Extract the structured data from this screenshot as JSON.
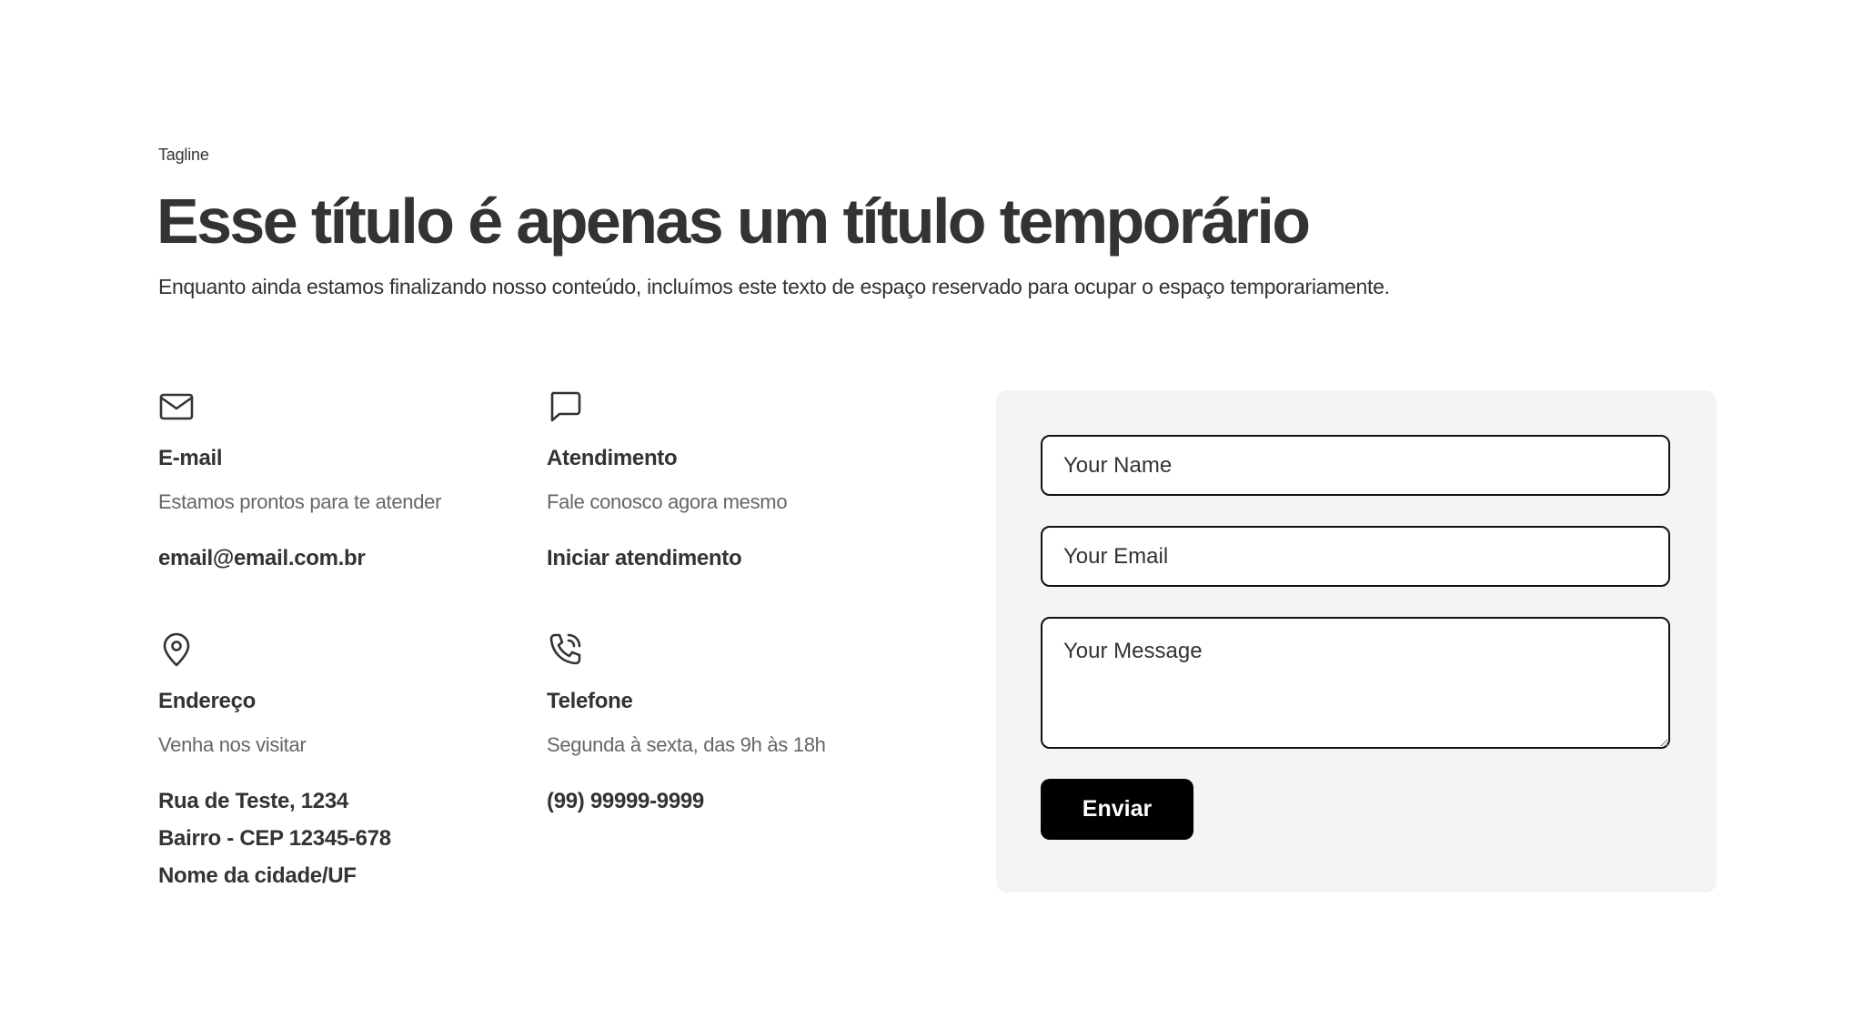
{
  "header": {
    "tagline": "Tagline",
    "title": "Esse título é apenas um título temporário",
    "subtitle": "Enquanto ainda estamos finalizando nosso conteúdo, incluímos este texto de espaço reservado para ocupar o espaço temporariamente."
  },
  "contact": {
    "email": {
      "icon": "mail-icon",
      "label": "E-mail",
      "description": "Estamos prontos para te atender",
      "value": "email@email.com.br"
    },
    "chat": {
      "icon": "chat-bubble-icon",
      "label": "Atendimento",
      "description": "Fale conosco agora mesmo",
      "value": "Iniciar atendimento"
    },
    "address": {
      "icon": "map-pin-icon",
      "label": "Endereço",
      "description": "Venha nos visitar",
      "lines": [
        "Rua de Teste, 1234",
        "Bairro - CEP 12345-678",
        "Nome da cidade/UF"
      ]
    },
    "phone": {
      "icon": "phone-call-icon",
      "label": "Telefone",
      "description": "Segunda à sexta, das 9h às 18h",
      "value": "(99) 99999-9999"
    }
  },
  "form": {
    "name_placeholder": "Your Name",
    "email_placeholder": "Your Email",
    "message_placeholder": "Your Message",
    "submit_label": "Enviar"
  },
  "colors": {
    "text": "#333333",
    "muted": "#666666",
    "panel": "#f4f4f4",
    "button": "#000000"
  }
}
